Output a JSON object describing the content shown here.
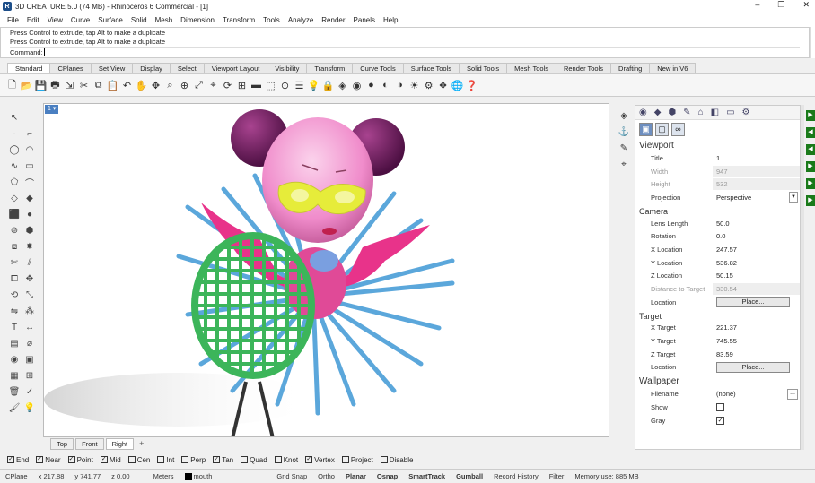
{
  "window": {
    "title": "3D CREATURE 5.0 (74 MB) - Rhinoceros 6 Commercial - [1]",
    "controls": [
      "–",
      "❐",
      "✕"
    ]
  },
  "menu": [
    "File",
    "Edit",
    "View",
    "Curve",
    "Surface",
    "Solid",
    "Mesh",
    "Dimension",
    "Transform",
    "Tools",
    "Analyze",
    "Render",
    "Panels",
    "Help"
  ],
  "command": {
    "history": [
      "Press Control to extrude, tap Alt to make a duplicate",
      "Press Control to extrude, tap Alt to make a duplicate"
    ],
    "prompt": "Command:"
  },
  "toolbar_tabs": [
    "Standard",
    "CPlanes",
    "Set View",
    "Display",
    "Select",
    "Viewport Layout",
    "Visibility",
    "Transform",
    "Curve Tools",
    "Surface Tools",
    "Solid Tools",
    "Mesh Tools",
    "Render Tools",
    "Drafting",
    "New in V6"
  ],
  "active_toolbar_tab": "Standard",
  "viewport": {
    "number": "1",
    "tabs": [
      "Top",
      "Front",
      "Right"
    ],
    "active_tab": "Right",
    "add": "+"
  },
  "properties": {
    "viewport_title": "Viewport",
    "rows_viewport": [
      {
        "key": "Title",
        "value": "1"
      },
      {
        "key": "Width",
        "value": "947"
      },
      {
        "key": "Height",
        "value": "532"
      },
      {
        "key": "Projection",
        "value": "Perspective"
      }
    ],
    "camera_title": "Camera",
    "rows_camera": [
      {
        "key": "Lens Length",
        "value": "50.0"
      },
      {
        "key": "Rotation",
        "value": "0.0"
      },
      {
        "key": "X Location",
        "value": "247.57"
      },
      {
        "key": "Y Location",
        "value": "536.82"
      },
      {
        "key": "Z Location",
        "value": "50.15"
      },
      {
        "key": "Distance to Target",
        "value": "330.54"
      },
      {
        "key": "Location",
        "value": "Place..."
      }
    ],
    "target_title": "Target",
    "rows_target": [
      {
        "key": "X Target",
        "value": "221.37"
      },
      {
        "key": "Y Target",
        "value": "745.55"
      },
      {
        "key": "Z Target",
        "value": "83.59"
      },
      {
        "key": "Location",
        "value": "Place..."
      }
    ],
    "wallpaper_title": "Wallpaper",
    "rows_wallpaper": [
      {
        "key": "Filename",
        "value": "(none)"
      },
      {
        "key": "Show",
        "value": ""
      },
      {
        "key": "Gray",
        "value": "✓"
      }
    ],
    "ellipsis": "..."
  },
  "osnap": [
    {
      "label": "End",
      "checked": true
    },
    {
      "label": "Near",
      "checked": true
    },
    {
      "label": "Point",
      "checked": true
    },
    {
      "label": "Mid",
      "checked": true
    },
    {
      "label": "Cen",
      "checked": false
    },
    {
      "label": "Int",
      "checked": false
    },
    {
      "label": "Perp",
      "checked": false
    },
    {
      "label": "Tan",
      "checked": true
    },
    {
      "label": "Quad",
      "checked": false
    },
    {
      "label": "Knot",
      "checked": false
    },
    {
      "label": "Vertex",
      "checked": true
    },
    {
      "label": "Project",
      "checked": false
    },
    {
      "label": "Disable",
      "checked": false
    }
  ],
  "status": {
    "cplane": "CPlane",
    "x": "x 217.88",
    "y": "y 741.77",
    "z": "z 0.00",
    "units": "Meters",
    "layer": "mouth",
    "toggles": [
      "Grid Snap",
      "Ortho",
      "Planar",
      "Osnap",
      "SmartTrack",
      "Gumball",
      "Record History",
      "Filter"
    ],
    "memory": "Memory use: 885 MB"
  },
  "colors": {
    "racket_green": "#3cb55a",
    "body_pink": "#e8338a",
    "spikes_blue": "#4a9ed8",
    "head_pink": "#f4a3d8",
    "hair_purple": "#6b1a5c",
    "visor_yellow": "#e6ec3a"
  }
}
